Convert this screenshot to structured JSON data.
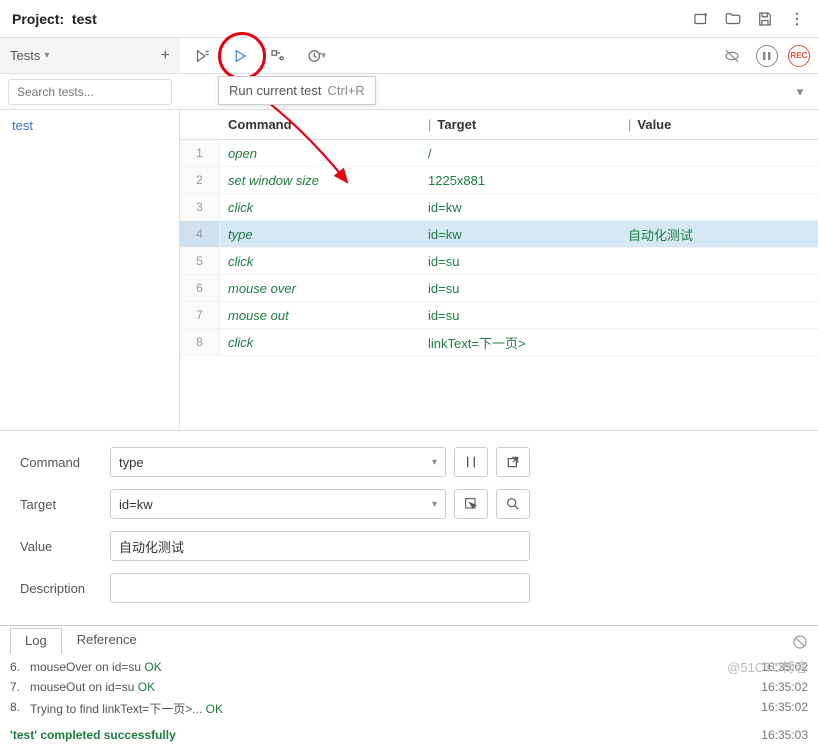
{
  "header": {
    "project_label": "Project:",
    "project_name": "test"
  },
  "sidebar_head": {
    "label": "Tests"
  },
  "tooltip": {
    "text": "Run current test",
    "shortcut": "Ctrl+R"
  },
  "search": {
    "placeholder": "Search tests..."
  },
  "tests": [
    {
      "name": "test"
    }
  ],
  "columns": {
    "command": "Command",
    "target": "Target",
    "value": "Value"
  },
  "rows": [
    {
      "n": "1",
      "cmd": "open",
      "tgt": "/",
      "val": ""
    },
    {
      "n": "2",
      "cmd": "set window size",
      "tgt": "1225x881",
      "val": ""
    },
    {
      "n": "3",
      "cmd": "click",
      "tgt": "id=kw",
      "val": ""
    },
    {
      "n": "4",
      "cmd": "type",
      "tgt": "id=kw",
      "val": "自动化测试"
    },
    {
      "n": "5",
      "cmd": "click",
      "tgt": "id=su",
      "val": ""
    },
    {
      "n": "6",
      "cmd": "mouse over",
      "tgt": "id=su",
      "val": ""
    },
    {
      "n": "7",
      "cmd": "mouse out",
      "tgt": "id=su",
      "val": ""
    },
    {
      "n": "8",
      "cmd": "click",
      "tgt": "linkText=下一页>",
      "val": ""
    }
  ],
  "selected_index": 3,
  "editor": {
    "command_label": "Command",
    "command_value": "type",
    "target_label": "Target",
    "target_value": "id=kw",
    "value_label": "Value",
    "value_value": "自动化测试",
    "description_label": "Description",
    "description_value": ""
  },
  "tabs": {
    "log": "Log",
    "reference": "Reference"
  },
  "log": [
    {
      "n": "6.",
      "text": "mouseOver on id=su ",
      "status": "OK",
      "ts": "16:35:02"
    },
    {
      "n": "7.",
      "text": "mouseOut on id=su ",
      "status": "OK",
      "ts": "16:35:02"
    },
    {
      "n": "8.",
      "text": "Trying to find linkText=下一页>... ",
      "status": "OK",
      "ts": "16:35:02"
    }
  ],
  "log_footer": {
    "text": "'test' completed successfully",
    "ts": "16:35:03"
  },
  "rec_label": "REC",
  "watermark": "@51CTO博客"
}
